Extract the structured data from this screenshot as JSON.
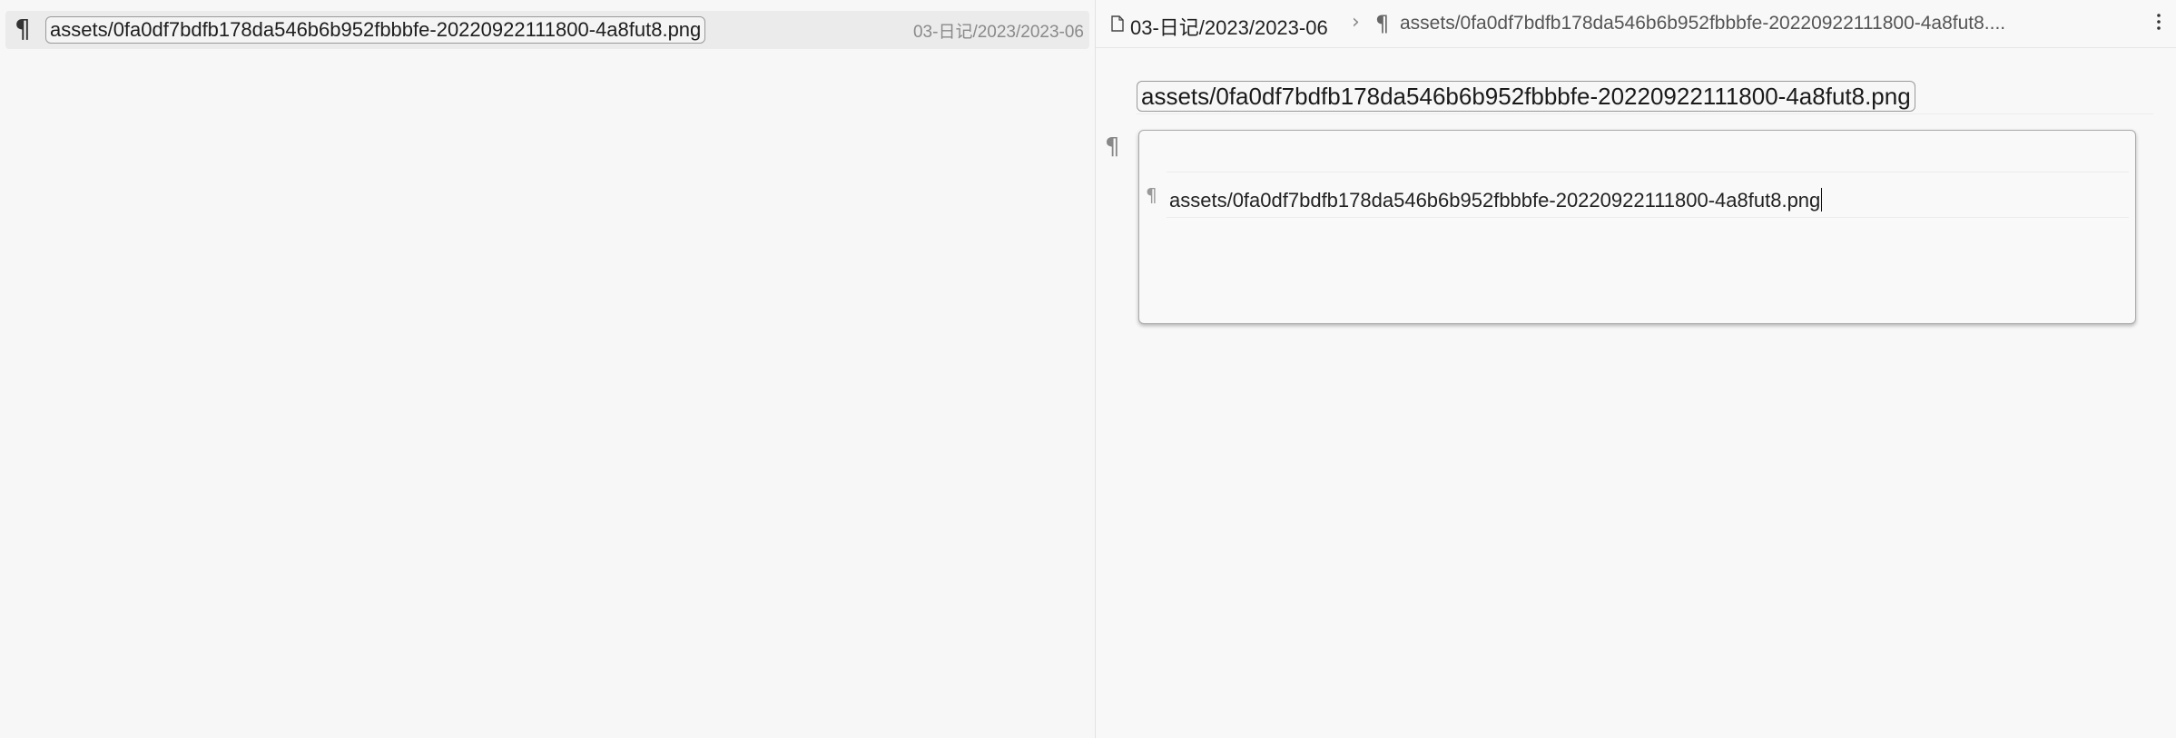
{
  "search_results": {
    "items": [
      {
        "icon": "pilcrow-icon",
        "title": "assets/0fa0df7bdfb178da546b6b952fbbbfe-20220922111800-4a8fut8.png",
        "path": "03-日记/2023/2023-06"
      }
    ]
  },
  "editor": {
    "breadcrumb": {
      "folder": "03-日记/2023/2023-06",
      "separator": "›",
      "block_icon": "pilcrow-icon",
      "block": "assets/0fa0df7bdfb178da546b6b952fbbbfe-20220922111800-4a8fut8...."
    },
    "title": "assets/0fa0df7bdfb178da546b6b952fbbbfe-20220922111800-4a8fut8.png",
    "embed": {
      "text": "assets/0fa0df7bdfb178da546b6b952fbbbfe-20220922111800-4a8fut8.png"
    },
    "glyphs": {
      "pilcrow": "¶"
    },
    "more_icon": "vertical-ellipsis-icon"
  }
}
